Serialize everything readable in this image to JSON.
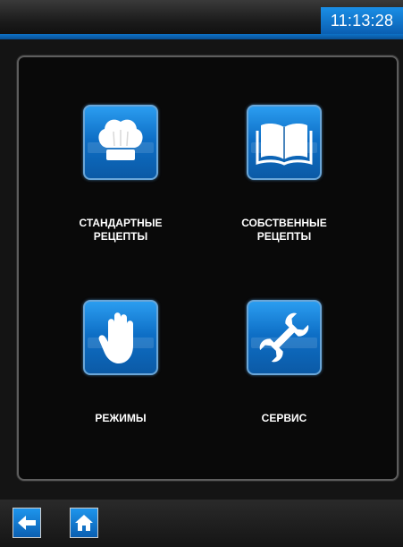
{
  "status_bar": {
    "clock": "11:13:28"
  },
  "menu": {
    "tiles": [
      {
        "label": "СТАНДАРТНЫЕ\nРЕЦЕПТЫ",
        "icon": "chef-hat-icon"
      },
      {
        "label": "СОБСТВЕННЫЕ\nРЕЦЕПТЫ",
        "icon": "open-book-icon"
      },
      {
        "label": "РЕЖИМЫ",
        "icon": "hand-icon"
      },
      {
        "label": "СЕРВИС",
        "icon": "wrench-icon"
      }
    ]
  },
  "navigation": {
    "back_icon": "arrow-left-icon",
    "home_icon": "home-icon"
  },
  "colors": {
    "accent": "#0e6fc6",
    "panel_border": "#5d5d5d",
    "background": "#141414"
  }
}
